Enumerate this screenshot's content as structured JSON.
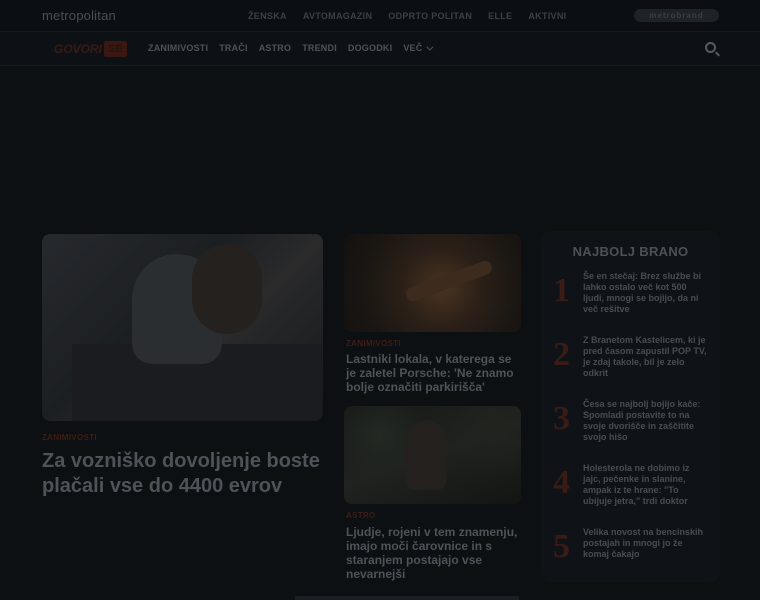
{
  "topbar": {
    "logo": "metropolitan",
    "links": [
      "ŽENSKA",
      "AVTOMAGAZIN",
      "ODPRTO POLITAN",
      "ELLE",
      "AKTIVNI"
    ],
    "brand": "metrobrand"
  },
  "navbar": {
    "site_logo_word": "GOVORI",
    "site_logo_box": "SE",
    "menu": [
      "ZANIMIVOSTI",
      "TRAČI",
      "ASTRO",
      "TRENDI",
      "DOGODKI",
      "VEČ"
    ]
  },
  "articles": {
    "main": {
      "tag": "ZANIMIVOSTI",
      "title": "Za vozniško dovoljenje boste plačali vse do 4400 evrov"
    },
    "side1": {
      "tag": "ZANIMIVOSTI",
      "title": "Lastniki lokala, v katerega se je zaletel Porsche: 'Ne znamo bolje označiti parkirišča'"
    },
    "side2": {
      "tag": "ASTRO",
      "title": "Ljudje, rojeni v tem znamenju, imajo moči čarovnice in s staranjem postajajo vse nevarnejši"
    }
  },
  "ranking": {
    "title": "NAJBOLJ BRANO",
    "items": [
      {
        "num": "1",
        "text": "Še en stečaj: Brez službe bi lahko ostalo več kot 500 ljudi, mnogi se bojijo, da ni več rešitve"
      },
      {
        "num": "2",
        "text": "Z Branetom Kastelicem, ki je pred časom zapustil POP TV, je zdaj takole, bil je zelo odkrit"
      },
      {
        "num": "3",
        "text": "Česa se najbolj bojijo kače: Spomladi postavite to na svoje dvorišče in zaščitite svojo hišo"
      },
      {
        "num": "4",
        "text": "Holesterola ne dobimo iz jajc, pečenke in slanine, ampak iz te hrane: \"To ubijuje jetra,\" trdi doktor"
      },
      {
        "num": "5",
        "text": "Velika novost na bencinskih postajah in mnogi jo že komaj čakajo"
      }
    ]
  }
}
